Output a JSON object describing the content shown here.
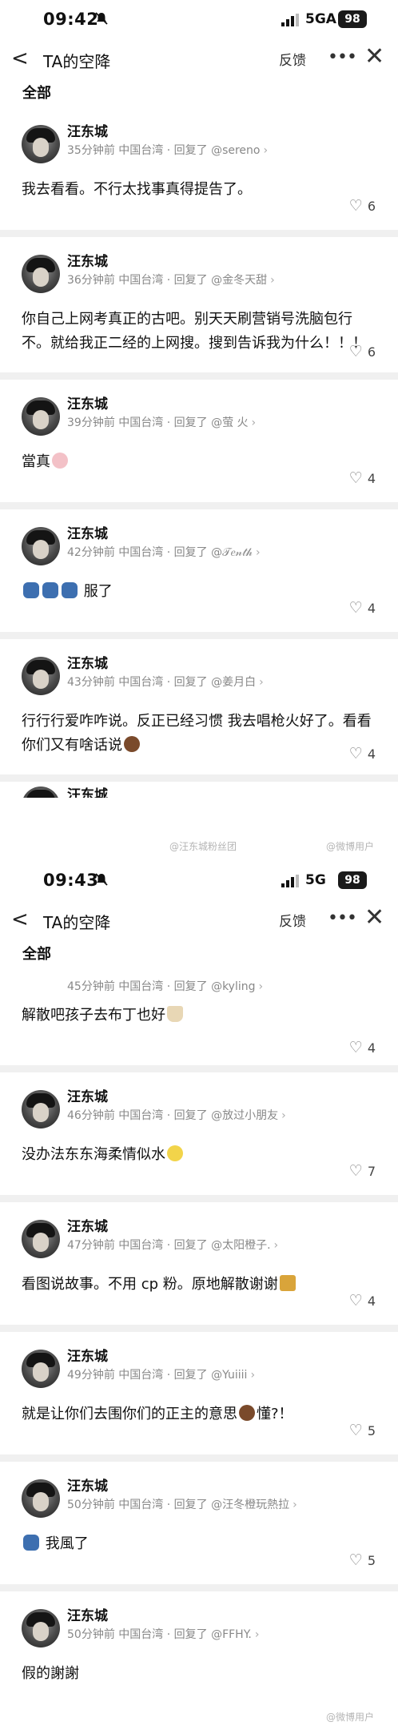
{
  "screens": [
    {
      "status": {
        "time": "09:42",
        "network": "5GA",
        "battery": "98"
      },
      "nav": {
        "title": "TA的空降",
        "feedback": "反馈",
        "more": "•••",
        "close": "✕",
        "back": "<"
      },
      "tab": "全部",
      "comments": [
        {
          "name": "汪东城",
          "meta": "35分钟前 中国台湾 · 回复了 @sereno",
          "text": "我去看看。不行太找事真得提告了。",
          "likes": "6"
        },
        {
          "name": "汪东城",
          "meta": "36分钟前 中国台湾 · 回复了 @金冬天甜",
          "text": "你自己上网考真正的古吧。别天天刷营销号洗脑包行不。就给我正二经的上网搜。搜到告诉我为什么！！！",
          "likes": "6"
        },
        {
          "name": "汪东城",
          "meta": "39分钟前 中国台湾 · 回复了 @萤 火",
          "text": "當真",
          "emoji": "pink",
          "likes": "4"
        },
        {
          "name": "汪东城",
          "meta": "42分钟前 中国台湾 · 回复了 @𝒯𝑒𝓃𝓉𝒽",
          "text": "服了",
          "emoji_prefix": "blue3",
          "likes": "4"
        },
        {
          "name": "汪东城",
          "meta": "43分钟前 中国台湾 · 回复了 @姜月白",
          "text": "行行行爱咋咋说。反正已经习惯 我去唱枪火好了。看看你们又有啥话说",
          "emoji": "brown",
          "likes": "4"
        }
      ],
      "partial_name": "汪东城"
    },
    {
      "status": {
        "time": "09:43",
        "network": "5G",
        "battery": "98"
      },
      "nav": {
        "title": "TA的空降",
        "feedback": "反馈",
        "more": "•••",
        "close": "✕",
        "back": "<"
      },
      "tab": "全部",
      "comments": [
        {
          "name": "",
          "meta": "45分钟前 中国台湾 · 回复了 @kyling",
          "text": "解散吧孩子去布丁也好",
          "emoji": "cup",
          "likes": "4"
        },
        {
          "name": "汪东城",
          "meta": "46分钟前 中国台湾 · 回复了 @放过小朋友",
          "text": "没办法东东海柔情似水",
          "emoji": "yellow",
          "likes": "7"
        },
        {
          "name": "汪东城",
          "meta": "47分钟前 中国台湾 · 回复了 @太阳橙子.",
          "text": "看图说故事。不用 cp 粉。原地解散谢谢",
          "emoji": "gold",
          "likes": "4"
        },
        {
          "name": "汪东城",
          "meta": "49分钟前 中国台湾 · 回复了 @Yuiiii",
          "text": "就是让你们去围你们的正主的意思",
          "emoji": "brown",
          "text_after": "懂?！",
          "likes": "5"
        },
        {
          "name": "汪东城",
          "meta": "50分钟前 中国台湾 · 回复了 @汪冬橙玩熱拉",
          "text": "我風了",
          "emoji_prefix": "blue1",
          "likes": "5"
        },
        {
          "name": "汪东城",
          "meta": "50分钟前 中国台湾 · 回复了 @FFHY.",
          "text": "假的謝謝",
          "likes": ""
        }
      ]
    }
  ],
  "watermarks": {
    "left": "@汪东城粉丝团",
    "right": "@微博用户",
    "bottom": "@微博用户"
  }
}
